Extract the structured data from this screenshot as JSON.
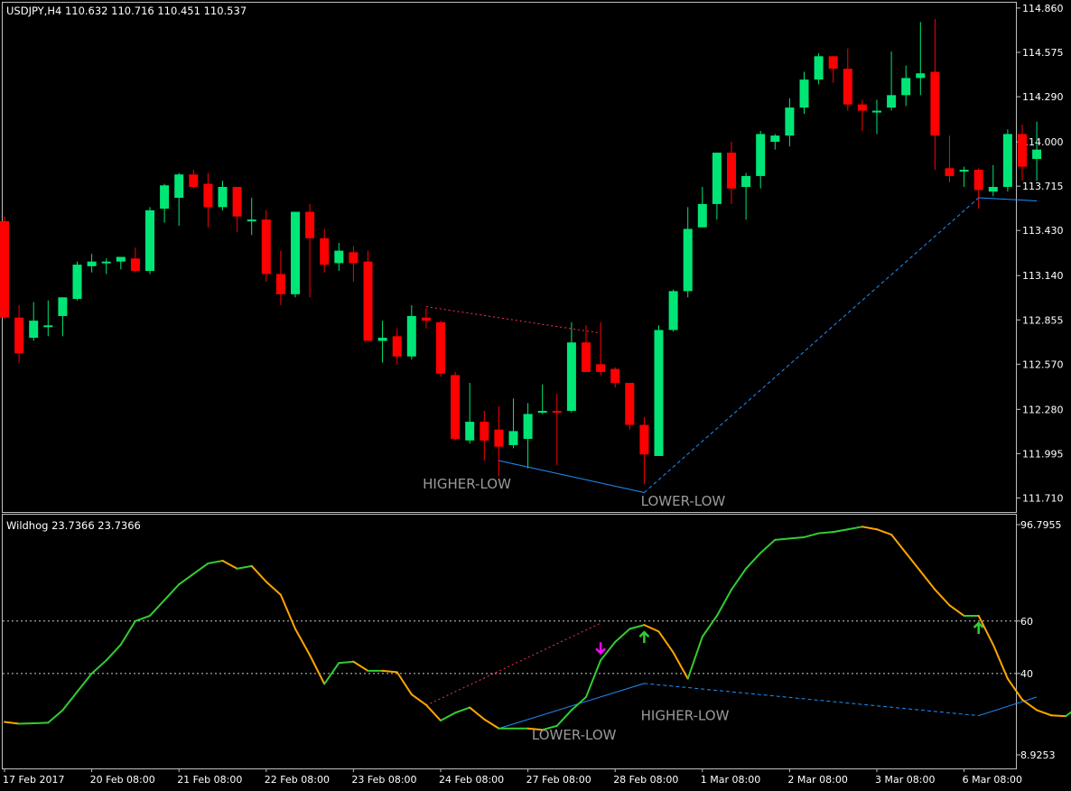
{
  "main_header": "USDJPY,H4  110.632 110.716 110.451 110.537",
  "indicator_header": "Wildhog 23.7366 23.7366",
  "colors": {
    "background": "#000000",
    "frame": "#c0c0c0",
    "bull_candle": "#00e676",
    "bear_candle": "#ff0000",
    "osc_rising": "#32cd32",
    "osc_falling": "#ffa500",
    "level_line": "#ffffff",
    "bearish_divergence": "#ff3050",
    "bullish_divergence": "#1e90ff",
    "sell_arrow": "#ff00ff",
    "buy_arrow": "#32cd32",
    "annotation_text": "#9a9a9a"
  },
  "chart_data": [
    {
      "type": "candlestick",
      "symbol": "USDJPY",
      "timeframe": "H4",
      "ylim": [
        111.62,
        114.9
      ],
      "y_ticks": [
        "114.860",
        "114.575",
        "114.290",
        "114.000",
        "113.715",
        "113.430",
        "113.140",
        "112.855",
        "112.570",
        "112.280",
        "111.995",
        "111.710"
      ],
      "x_ticks": [
        "17 Feb 2017",
        "20 Feb 08:00",
        "21 Feb 08:00",
        "22 Feb 08:00",
        "23 Feb 08:00",
        "24 Feb 08:00",
        "27 Feb 08:00",
        "28 Feb 08:00",
        "1 Mar 08:00",
        "2 Mar 08:00",
        "3 Mar 08:00",
        "6 Mar 08:00"
      ],
      "candles": [
        {
          "o": 113.49,
          "h": 113.52,
          "l": 112.86,
          "c": 112.87
        },
        {
          "o": 112.87,
          "h": 112.95,
          "l": 112.58,
          "c": 112.64
        },
        {
          "o": 112.74,
          "h": 112.97,
          "l": 112.72,
          "c": 112.85
        },
        {
          "o": 112.81,
          "h": 112.98,
          "l": 112.75,
          "c": 112.82
        },
        {
          "o": 112.88,
          "h": 113.0,
          "l": 112.75,
          "c": 113.0
        },
        {
          "o": 112.99,
          "h": 113.23,
          "l": 112.98,
          "c": 113.21
        },
        {
          "o": 113.2,
          "h": 113.28,
          "l": 113.16,
          "c": 113.23
        },
        {
          "o": 113.22,
          "h": 113.25,
          "l": 113.15,
          "c": 113.23
        },
        {
          "o": 113.23,
          "h": 113.25,
          "l": 113.18,
          "c": 113.26
        },
        {
          "o": 113.25,
          "h": 113.32,
          "l": 113.16,
          "c": 113.17
        },
        {
          "o": 113.17,
          "h": 113.58,
          "l": 113.15,
          "c": 113.56
        },
        {
          "o": 113.57,
          "h": 113.73,
          "l": 113.48,
          "c": 113.72
        },
        {
          "o": 113.64,
          "h": 113.8,
          "l": 113.46,
          "c": 113.79
        },
        {
          "o": 113.79,
          "h": 113.82,
          "l": 113.7,
          "c": 113.71
        },
        {
          "o": 113.73,
          "h": 113.8,
          "l": 113.45,
          "c": 113.58
        },
        {
          "o": 113.58,
          "h": 113.75,
          "l": 113.56,
          "c": 113.71
        },
        {
          "o": 113.71,
          "h": 113.71,
          "l": 113.42,
          "c": 113.52
        },
        {
          "o": 113.5,
          "h": 113.64,
          "l": 113.4,
          "c": 113.5
        },
        {
          "o": 113.5,
          "h": 113.56,
          "l": 113.1,
          "c": 113.15
        },
        {
          "o": 113.15,
          "h": 113.3,
          "l": 112.95,
          "c": 113.02
        },
        {
          "o": 113.02,
          "h": 113.54,
          "l": 113.0,
          "c": 113.55
        },
        {
          "o": 113.55,
          "h": 113.6,
          "l": 113.0,
          "c": 113.38
        },
        {
          "o": 113.38,
          "h": 113.44,
          "l": 113.16,
          "c": 113.21
        },
        {
          "o": 113.22,
          "h": 113.35,
          "l": 113.17,
          "c": 113.3
        },
        {
          "o": 113.29,
          "h": 113.33,
          "l": 113.1,
          "c": 113.22
        },
        {
          "o": 113.23,
          "h": 113.3,
          "l": 112.72,
          "c": 112.72
        },
        {
          "o": 112.72,
          "h": 112.85,
          "l": 112.58,
          "c": 112.74
        },
        {
          "o": 112.75,
          "h": 112.8,
          "l": 112.57,
          "c": 112.62
        },
        {
          "o": 112.62,
          "h": 112.95,
          "l": 112.6,
          "c": 112.88
        },
        {
          "o": 112.87,
          "h": 112.93,
          "l": 112.8,
          "c": 112.85
        },
        {
          "o": 112.84,
          "h": 112.85,
          "l": 112.49,
          "c": 112.51
        },
        {
          "o": 112.5,
          "h": 112.52,
          "l": 112.08,
          "c": 112.09
        },
        {
          "o": 112.08,
          "h": 112.45,
          "l": 112.06,
          "c": 112.2
        },
        {
          "o": 112.2,
          "h": 112.27,
          "l": 111.95,
          "c": 112.08
        },
        {
          "o": 112.15,
          "h": 112.3,
          "l": 111.85,
          "c": 112.04
        },
        {
          "o": 112.05,
          "h": 112.35,
          "l": 112.03,
          "c": 112.14
        },
        {
          "o": 112.09,
          "h": 112.32,
          "l": 111.9,
          "c": 112.25
        },
        {
          "o": 112.26,
          "h": 112.44,
          "l": 112.25,
          "c": 112.27
        },
        {
          "o": 112.27,
          "h": 112.38,
          "l": 111.92,
          "c": 112.26
        },
        {
          "o": 112.27,
          "h": 112.84,
          "l": 112.26,
          "c": 112.71
        },
        {
          "o": 112.71,
          "h": 112.82,
          "l": 112.6,
          "c": 112.52
        },
        {
          "o": 112.57,
          "h": 112.84,
          "l": 112.5,
          "c": 112.52
        },
        {
          "o": 112.54,
          "h": 112.55,
          "l": 112.42,
          "c": 112.45
        },
        {
          "o": 112.45,
          "h": 112.45,
          "l": 112.15,
          "c": 112.18
        },
        {
          "o": 112.18,
          "h": 112.23,
          "l": 111.8,
          "c": 111.99
        },
        {
          "o": 111.98,
          "h": 112.82,
          "l": 111.98,
          "c": 112.79
        },
        {
          "o": 112.79,
          "h": 113.05,
          "l": 112.78,
          "c": 113.04
        },
        {
          "o": 113.04,
          "h": 113.58,
          "l": 113.0,
          "c": 113.44
        },
        {
          "o": 113.45,
          "h": 113.71,
          "l": 113.45,
          "c": 113.6
        },
        {
          "o": 113.6,
          "h": 113.92,
          "l": 113.5,
          "c": 113.93
        },
        {
          "o": 113.93,
          "h": 114.0,
          "l": 113.6,
          "c": 113.7
        },
        {
          "o": 113.71,
          "h": 113.8,
          "l": 113.5,
          "c": 113.78
        },
        {
          "o": 113.78,
          "h": 114.07,
          "l": 113.7,
          "c": 114.05
        },
        {
          "o": 114.0,
          "h": 114.05,
          "l": 113.95,
          "c": 114.04
        },
        {
          "o": 114.04,
          "h": 114.28,
          "l": 113.97,
          "c": 114.22
        },
        {
          "o": 114.22,
          "h": 114.45,
          "l": 114.18,
          "c": 114.4
        },
        {
          "o": 114.4,
          "h": 114.57,
          "l": 114.37,
          "c": 114.55
        },
        {
          "o": 114.55,
          "h": 114.52,
          "l": 114.38,
          "c": 114.47
        },
        {
          "o": 114.47,
          "h": 114.6,
          "l": 114.2,
          "c": 114.24
        },
        {
          "o": 114.24,
          "h": 114.27,
          "l": 114.07,
          "c": 114.2
        },
        {
          "o": 114.2,
          "h": 114.27,
          "l": 114.05,
          "c": 114.2
        },
        {
          "o": 114.22,
          "h": 114.58,
          "l": 114.2,
          "c": 114.3
        },
        {
          "o": 114.3,
          "h": 114.49,
          "l": 114.23,
          "c": 114.41
        },
        {
          "o": 114.41,
          "h": 114.77,
          "l": 114.3,
          "c": 114.44
        },
        {
          "o": 114.45,
          "h": 114.79,
          "l": 113.82,
          "c": 114.04
        },
        {
          "o": 113.83,
          "h": 114.04,
          "l": 113.74,
          "c": 113.78
        },
        {
          "o": 113.81,
          "h": 113.84,
          "l": 113.71,
          "c": 113.82
        },
        {
          "o": 113.82,
          "h": 113.83,
          "l": 113.57,
          "c": 113.69
        },
        {
          "o": 113.68,
          "h": 113.85,
          "l": 113.65,
          "c": 113.71
        },
        {
          "o": 113.71,
          "h": 114.08,
          "l": 113.68,
          "c": 114.05
        },
        {
          "o": 114.05,
          "h": 114.11,
          "l": 113.75,
          "c": 113.84
        },
        {
          "o": 113.89,
          "h": 114.13,
          "l": 113.75,
          "c": 113.95
        }
      ],
      "divergence_lines": [
        {
          "style": "dotted",
          "color": "bear",
          "from": {
            "i": 29,
            "price": 112.94
          },
          "to": {
            "i": 41,
            "price": 112.77
          }
        },
        {
          "style": "solid",
          "color": "bull",
          "from": {
            "i": 34,
            "price": 111.95
          },
          "to": {
            "i": 44,
            "price": 111.745
          }
        },
        {
          "style": "dashed",
          "color": "bull",
          "from": {
            "i": 44,
            "price": 111.745
          },
          "to": {
            "i": 67,
            "price": 113.64
          }
        },
        {
          "style": "solid",
          "color": "bull",
          "from": {
            "i": 67,
            "price": 113.64
          },
          "to": {
            "i": 71,
            "price": 113.62
          }
        }
      ],
      "annotations": [
        {
          "text": "HIGHER-LOW",
          "i": 31.5,
          "price": 111.8
        },
        {
          "text": "LOWER-LOW",
          "i": 46.5,
          "price": 111.69
        }
      ]
    },
    {
      "type": "line",
      "name": "Wildhog",
      "ylim": [
        8.9253,
        96.7955
      ],
      "y_ticks": [
        "96.7955",
        "60",
        "40",
        "8.9253"
      ],
      "levels": [
        60,
        40
      ],
      "values": [
        21.5,
        20.8,
        21,
        21.2,
        26,
        33,
        40,
        45,
        51,
        60,
        62,
        68,
        74,
        78,
        82,
        83,
        80,
        81,
        75,
        70,
        57,
        47,
        36,
        44,
        44.5,
        41,
        41,
        40.5,
        32,
        28,
        22,
        25,
        27,
        22.5,
        19,
        19,
        19,
        18.5,
        20,
        26,
        31,
        45,
        52,
        57,
        58.5,
        56,
        48,
        38,
        54,
        62,
        72,
        80,
        86,
        91,
        91.5,
        92,
        93.5,
        94,
        95,
        96,
        95,
        93,
        86,
        79,
        72,
        66,
        62,
        62,
        51,
        38,
        30,
        26,
        24,
        23.7,
        28,
        29,
        31
      ],
      "divergence_lines": [
        {
          "style": "dotted",
          "color": "bear",
          "from": {
            "i": 29,
            "v": 27.8
          },
          "to": {
            "i": 41,
            "v": 59.2
          }
        },
        {
          "style": "solid",
          "color": "bull",
          "from": {
            "i": 34,
            "v": 19
          },
          "to": {
            "i": 44,
            "v": 36.2
          }
        },
        {
          "style": "dashed",
          "color": "bull",
          "from": {
            "i": 44,
            "v": 36.2
          },
          "to": {
            "i": 67,
            "v": 23.9
          }
        },
        {
          "style": "solid",
          "color": "bull",
          "from": {
            "i": 67,
            "v": 23.9
          },
          "to": {
            "i": 71,
            "v": 31
          }
        }
      ],
      "signals": [
        {
          "kind": "sell",
          "i": 41
        },
        {
          "kind": "buy",
          "i": 44
        },
        {
          "kind": "buy",
          "i": 67
        }
      ],
      "annotations": [
        {
          "text": "HIGHER-LOW",
          "i": 46.5,
          "v": 24
        },
        {
          "text": "LOWER-LOW",
          "i": 39,
          "v": 16.5
        }
      ]
    }
  ]
}
